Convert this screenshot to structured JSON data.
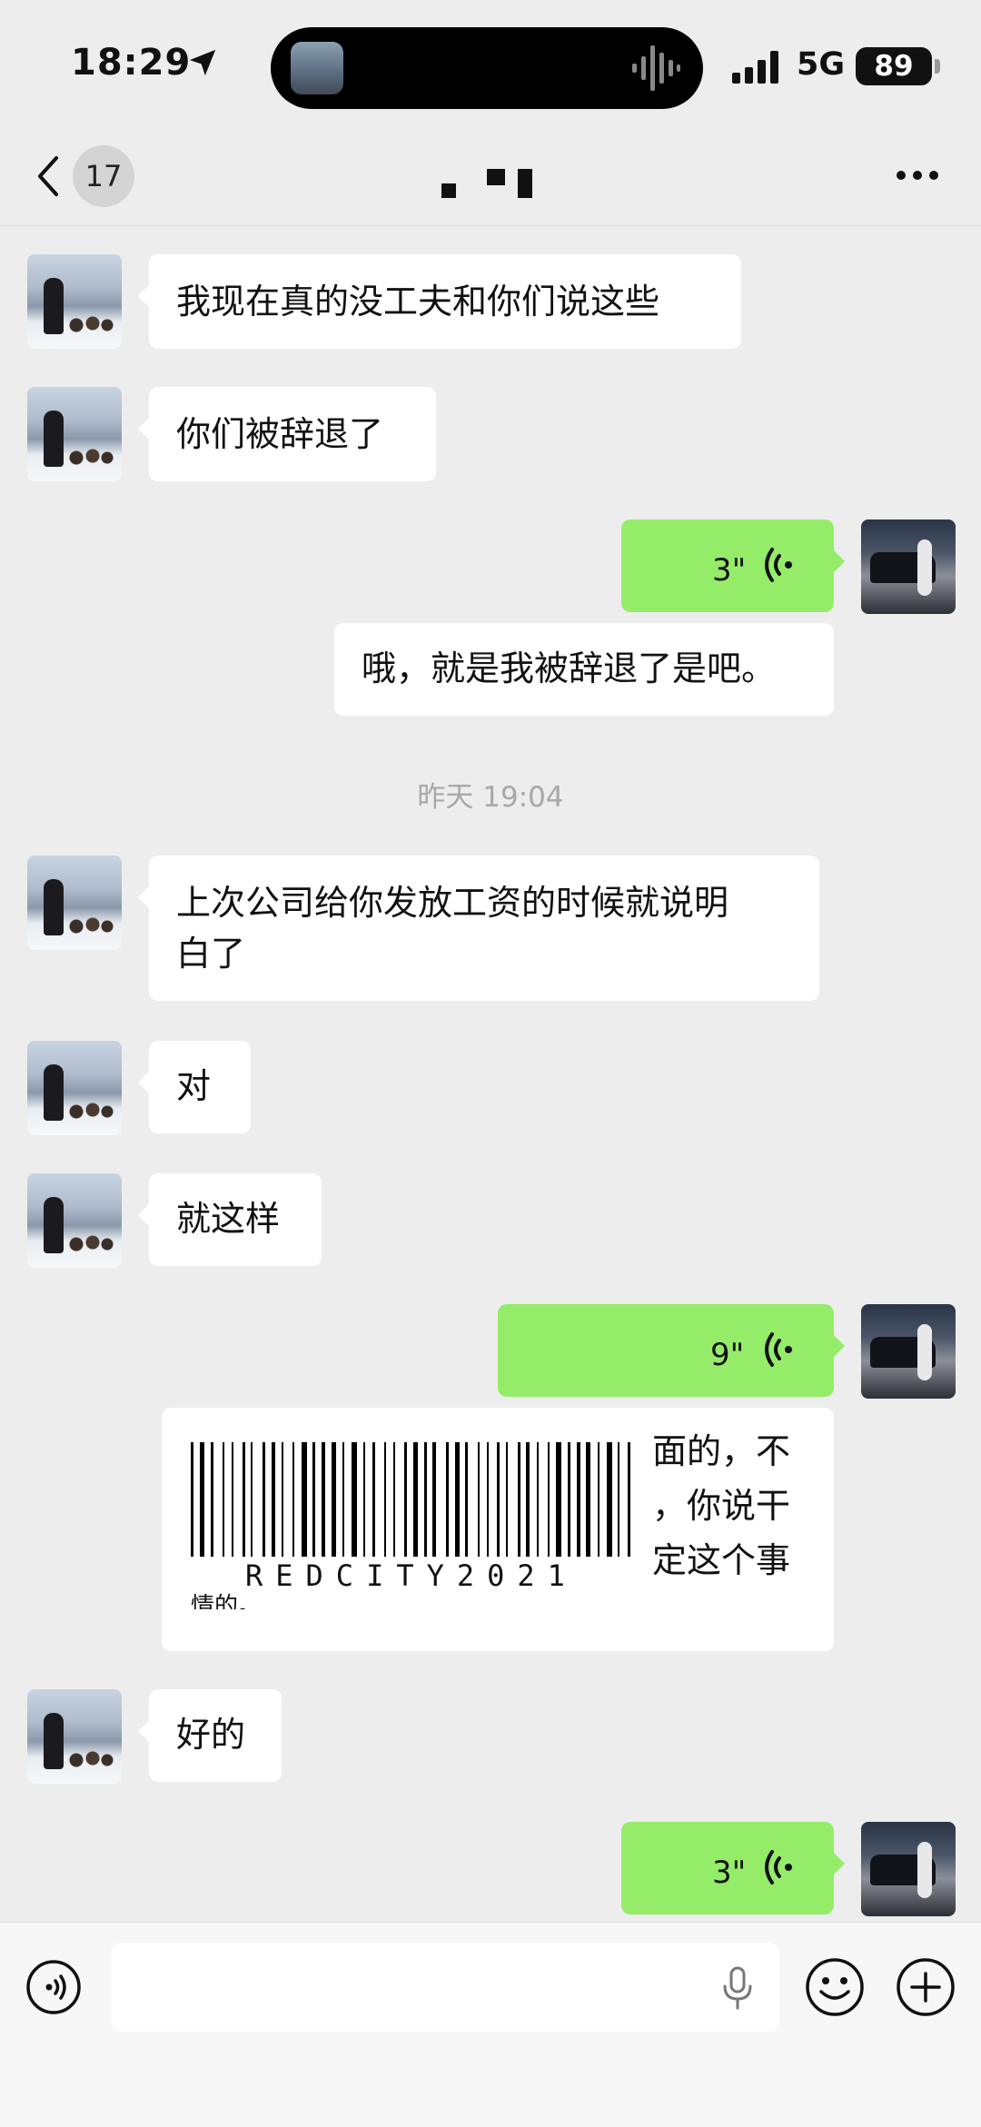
{
  "status_bar": {
    "time": "18:29",
    "network": "5G",
    "battery": "89"
  },
  "nav": {
    "unread_count": "17"
  },
  "messages": [
    {
      "side": "left",
      "text": "我现在真的没工夫和你们说这些"
    },
    {
      "side": "left",
      "text": "你们被辞退了"
    },
    {
      "side": "right",
      "type": "voice",
      "duration": "3\"",
      "transcript": "哦，就是我被辞退了是吧。"
    },
    {
      "side": "left",
      "text": "上次公司给你发放工资的时候就说明白了",
      "line1": "上次公司给你发放工资的时候就说明",
      "line2": "白了"
    },
    {
      "side": "left",
      "text": "对"
    },
    {
      "side": "left",
      "text": "就这样"
    },
    {
      "side": "right",
      "type": "voice",
      "duration": "9\"",
      "transcript_visible": [
        "面的，不",
        "，你说干",
        "定这个事",
        "情的。"
      ]
    },
    {
      "side": "left",
      "text": "好的"
    },
    {
      "side": "right",
      "type": "voice",
      "duration": "3\""
    }
  ],
  "timestamp": "昨天 19:04",
  "watermark": "REDCITY2021",
  "colors": {
    "background": "#ededed",
    "sent_bubble": "#95ec69",
    "received_bubble": "#ffffff"
  },
  "icons": [
    "location-arrow-icon",
    "sound-wave-icon",
    "signal-bars-icon",
    "back-chevron-icon",
    "more-dots-icon",
    "voice-wave-icon",
    "voice-mode-icon",
    "microphone-icon",
    "emoji-icon",
    "plus-icon"
  ]
}
